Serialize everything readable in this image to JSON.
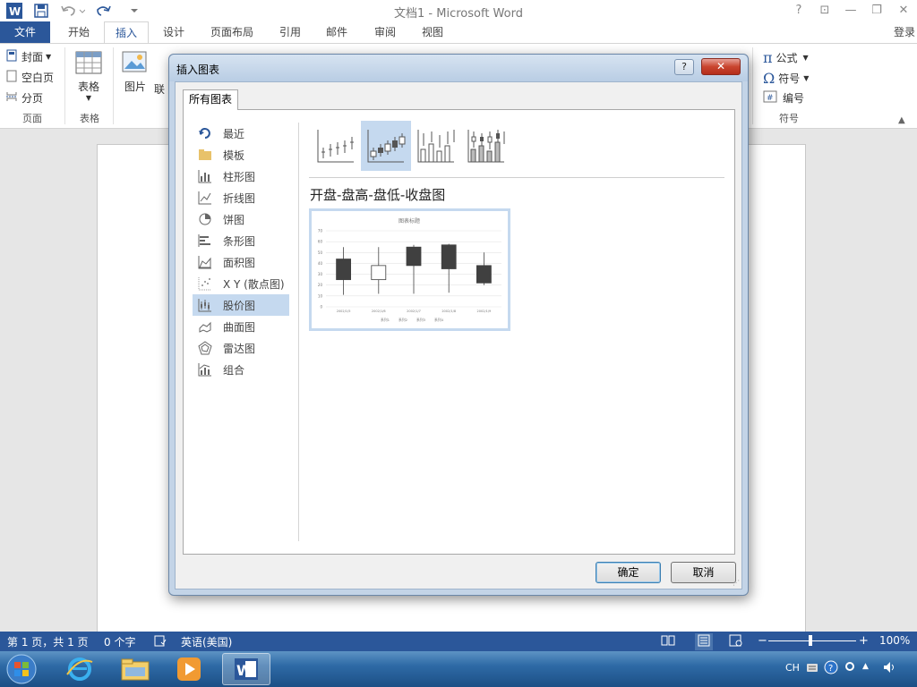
{
  "window": {
    "title": "文档1 - Microsoft Word",
    "help_glyph": "?",
    "restore_ribbon_glyph": "⊡",
    "minimize_glyph": "—",
    "maximize_glyph": "❐",
    "close_glyph": "✕"
  },
  "ribbon_tabs": {
    "file": "文件",
    "home": "开始",
    "insert": "插入",
    "design": "设计",
    "layout": "页面布局",
    "references": "引用",
    "mailings": "邮件",
    "review": "审阅",
    "view": "视图",
    "login": "登录"
  },
  "ribbon": {
    "pages": {
      "cover": "封面",
      "blank": "空白页",
      "break": "分页",
      "group": "页面"
    },
    "tables": {
      "table": "表格",
      "group": "表格"
    },
    "illustrations": {
      "picture": "图片",
      "online_truncated": "联"
    },
    "symbols": {
      "equation": "公式",
      "symbol": "符号",
      "number": "编号",
      "group": "符号"
    }
  },
  "dialog": {
    "title": "插入图表",
    "help_label": "?",
    "close_label": "✕",
    "tab_label": "所有图表",
    "chart_types": [
      {
        "label": "最近",
        "icon": "recent-icon"
      },
      {
        "label": "模板",
        "icon": "folder-icon"
      },
      {
        "label": "柱形图",
        "icon": "column-chart-icon"
      },
      {
        "label": "折线图",
        "icon": "line-chart-icon"
      },
      {
        "label": "饼图",
        "icon": "pie-chart-icon"
      },
      {
        "label": "条形图",
        "icon": "bar-chart-icon"
      },
      {
        "label": "面积图",
        "icon": "area-chart-icon"
      },
      {
        "label": "X Y (散点图)",
        "icon": "scatter-chart-icon"
      },
      {
        "label": "股价图",
        "icon": "stock-chart-icon",
        "selected": true
      },
      {
        "label": "曲面图",
        "icon": "surface-chart-icon"
      },
      {
        "label": "雷达图",
        "icon": "radar-chart-icon"
      },
      {
        "label": "组合",
        "icon": "combo-chart-icon"
      }
    ],
    "selected_subtype_name": "开盘-盘高-盘低-收盘图",
    "ok_label": "确定",
    "cancel_label": "取消"
  },
  "chart_data": {
    "type": "stock",
    "title": "图表标题",
    "ylim": [
      0,
      70
    ],
    "y_ticks": [
      0,
      10,
      20,
      30,
      40,
      50,
      60,
      70
    ],
    "categories": [
      "2002/1/5",
      "2002/1/6",
      "2002/1/7",
      "2002/1/8",
      "2002/1/9"
    ],
    "series": [
      {
        "name": "系列1",
        "values": [
          44,
          25,
          55,
          57,
          38
        ]
      },
      {
        "name": "系列2",
        "values": [
          55,
          55,
          57,
          58,
          50
        ]
      },
      {
        "name": "系列3",
        "values": [
          11,
          12,
          12,
          13,
          20
        ]
      },
      {
        "name": "系列4",
        "values": [
          25,
          38,
          38,
          35,
          22
        ]
      }
    ]
  },
  "status": {
    "page": "第 1 页，共 1 页",
    "words": "0 个字",
    "language": "英语(美国)",
    "zoom": "100%"
  },
  "taskbar": {
    "tray_lang": "CH"
  }
}
